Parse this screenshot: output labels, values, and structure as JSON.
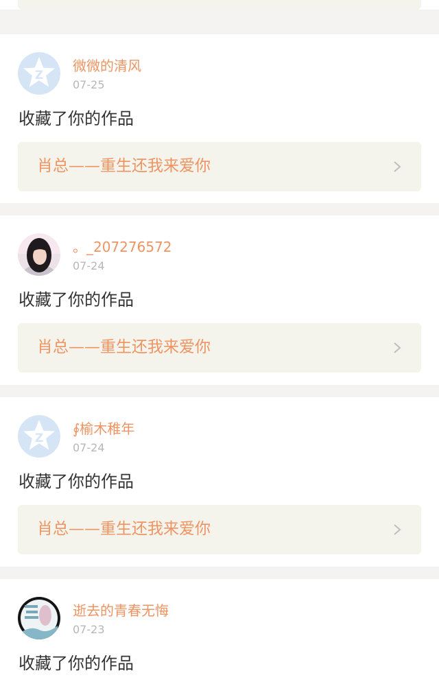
{
  "notifications": [
    {
      "username": "微微的清风",
      "date": "07-25",
      "action": "收藏了你的作品",
      "work_title": "肖总——重生还我来爱你",
      "avatar": "default-avatar-icon"
    },
    {
      "username": "。_207276572",
      "date": "07-24",
      "action": "收藏了你的作品",
      "work_title": "肖总——重生还我来爱你",
      "avatar": "user-photo"
    },
    {
      "username": "∮榆木稚年",
      "date": "07-24",
      "action": "收藏了你的作品",
      "work_title": "肖总——重生还我来爱你",
      "avatar": "default-avatar-icon"
    },
    {
      "username": "逝去的青春无悔",
      "date": "07-23",
      "action": "收藏了你的作品",
      "work_title": "",
      "avatar": "user-artwork"
    }
  ],
  "icons": {
    "chevron": "chevron-right-icon",
    "default_avatar": "default-avatar-icon"
  },
  "colors": {
    "accent": "#ee9462",
    "date": "#b7b7b7",
    "action_text": "#333333",
    "link_background": "#f5f4ec",
    "page_background": "#f4f3f2",
    "card_background": "#ffffff",
    "default_avatar_background": "#d6e5f6"
  }
}
